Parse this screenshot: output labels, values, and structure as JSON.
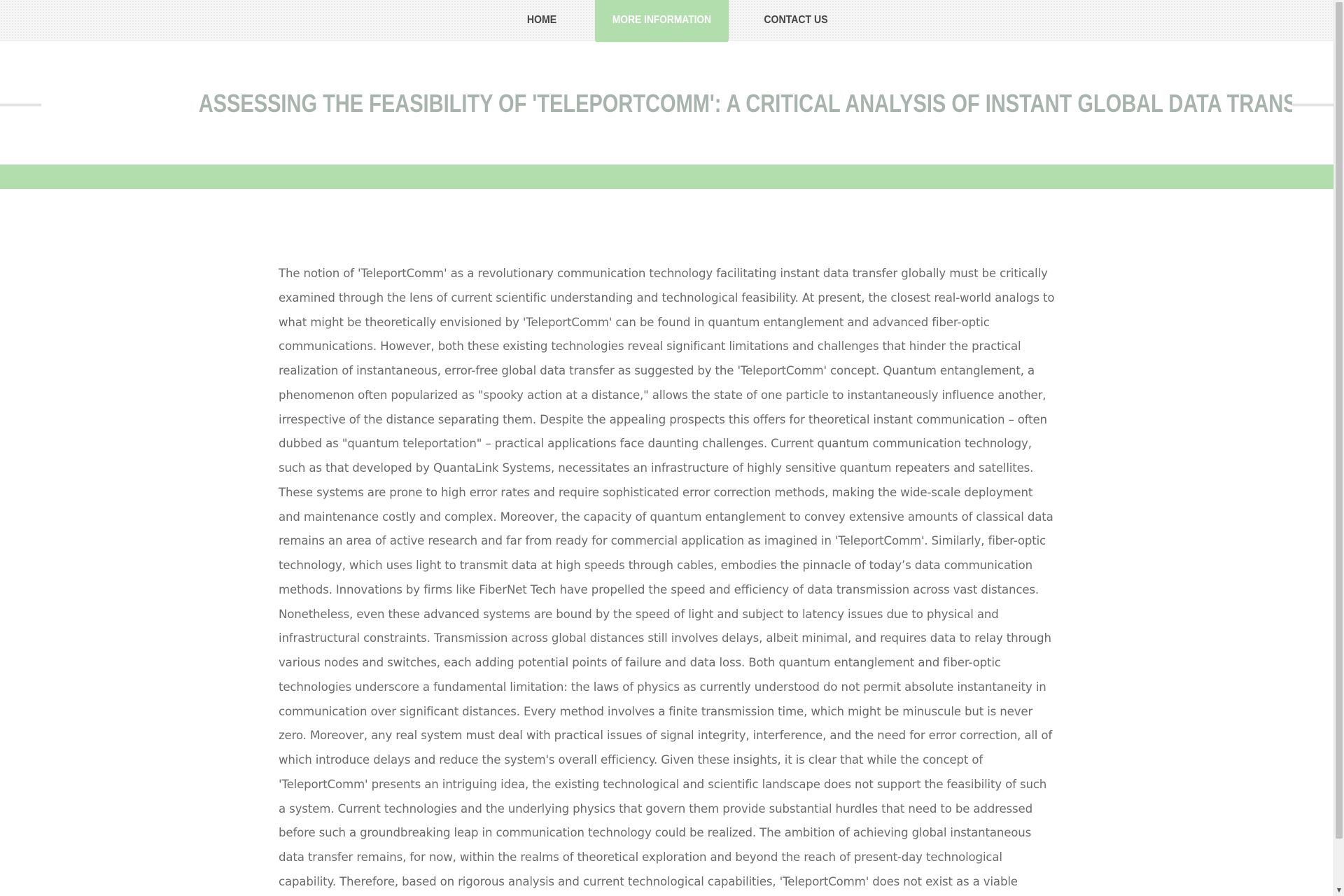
{
  "nav": {
    "items": [
      {
        "label": "HOME"
      },
      {
        "label": "MORE INFORMATION",
        "active": true
      },
      {
        "label": "CONTACT US"
      }
    ]
  },
  "article": {
    "title": "ASSESSING THE FEASIBILITY OF 'TELEPORTCOMM': A CRITICAL ANALYSIS OF INSTANT GLOBAL DATA TRANSFER TECHNOLOGIES",
    "body": "The notion of 'TeleportComm' as a revolutionary communication technology facilitating instant data transfer globally must be critically examined through the lens of current scientific understanding and technological feasibility. At present, the closest real-world analogs to what might be theoretically envisioned by 'TeleportComm' can be found in quantum entanglement and advanced fiber-optic communications. However, both these existing technologies reveal significant limitations and challenges that hinder the practical realization of instantaneous, error-free global data transfer as suggested by the 'TeleportComm' concept. Quantum entanglement, a phenomenon often popularized as \"spooky action at a distance,\" allows the state of one particle to instantaneously influence another, irrespective of the distance separating them. Despite the appealing prospects this offers for theoretical instant communication – often dubbed as \"quantum teleportation\" – practical applications face daunting challenges. Current quantum communication technology, such as that developed by QuantaLink Systems, necessitates an infrastructure of highly sensitive quantum repeaters and satellites. These systems are prone to high error rates and require sophisticated error correction methods, making the wide-scale deployment and maintenance costly and complex. Moreover, the capacity of quantum entanglement to convey extensive amounts of classical data remains an area of active research and far from ready for commercial application as imagined in 'TeleportComm'. Similarly, fiber-optic technology, which uses light to transmit data at high speeds through cables, embodies the pinnacle of today’s data communication methods. Innovations by firms like FiberNet Tech have propelled the speed and efficiency of data transmission across vast distances. Nonetheless, even these advanced systems are bound by the speed of light and subject to latency issues due to physical and infrastructural constraints. Transmission across global distances still involves delays, albeit minimal, and requires data to relay through various nodes and switches, each adding potential points of failure and data loss. Both quantum entanglement and fiber-optic technologies underscore a fundamental limitation: the laws of physics as currently understood do not permit absolute instantaneity in communication over significant distances. Every method involves a finite transmission time, which might be minuscule but is never zero. Moreover, any real system must deal with practical issues of signal integrity, interference, and the need for error correction, all of which introduce delays and reduce the system's overall efficiency. Given these insights, it is clear that while the concept of 'TeleportComm' presents an intriguing idea, the existing technological and scientific landscape does not support the feasibility of such a system. Current technologies and the underlying physics that govern them provide substantial hurdles that need to be addressed before such a groundbreaking leap in communication technology could be realized. The ambition of achieving global instantaneous data transfer remains, for now, within the realms of theoretical exploration and beyond the reach of present-day technological capability. Therefore, based on rigorous analysis and current technological capabilities, 'TeleportComm' does not exist as a viable means of communication."
  },
  "icons": {
    "scroll_down": "chevron-down-icon"
  },
  "colors": {
    "accent_green": "#b2ddad",
    "title_gray": "#a9b3ad",
    "body_text": "#6b6b6b"
  }
}
